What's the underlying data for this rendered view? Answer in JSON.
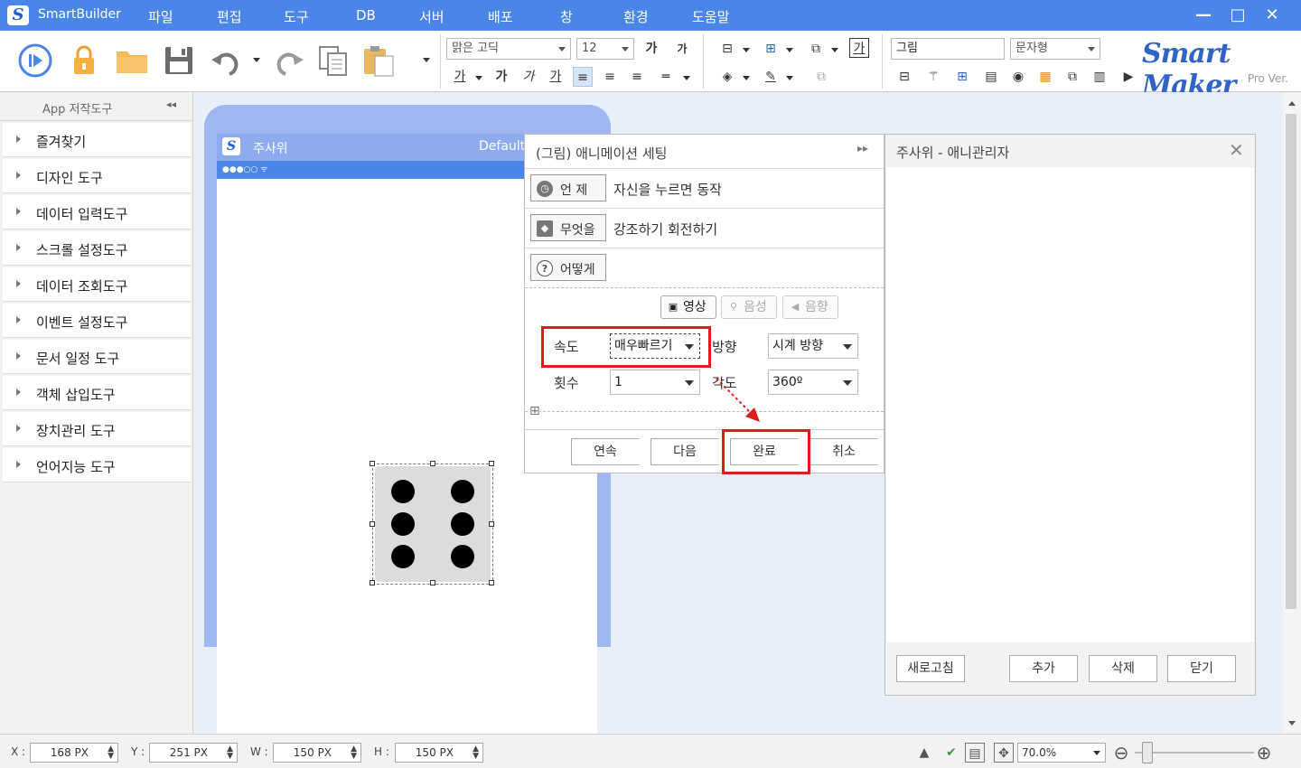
{
  "app": {
    "title": "SmartBuilder",
    "logo_letter": "S"
  },
  "menu": [
    "파일",
    "편집",
    "도구",
    "DB",
    "서버",
    "배포",
    "창",
    "환경",
    "도움말"
  ],
  "window_controls": {
    "minimize": "—",
    "maximize": "□",
    "close": "✕"
  },
  "toolbar": {
    "font_name": "맑은 고딕",
    "font_size": "12",
    "object_name": "그림",
    "text_type": "문자형",
    "format_row1": [
      "가",
      "가"
    ],
    "format_row2": [
      "가",
      "가",
      "가",
      "가"
    ]
  },
  "brand": {
    "name": "Smart Maker",
    "version": "Pro Ver."
  },
  "sidebar": {
    "title": "App 저작도구",
    "collapse": "◂◂",
    "items": [
      "즐겨찾기",
      "디자인 도구",
      "데이터 입력도구",
      "스크롤 설정도구",
      "데이터 조회도구",
      "이벤트 설정도구",
      "문서 일정 도구",
      "객체 삽입도구",
      "장치관리 도구",
      "언어지능 도구"
    ]
  },
  "phone": {
    "title": "주사위",
    "default_label": "Default",
    "status": "●●●○○ ᯤ"
  },
  "dice": {
    "value": 6,
    "pip_color": "#000000",
    "face_color": "#dcdcdc"
  },
  "anim_panel": {
    "title": "(그림) 애니메이션 세팅",
    "expand": "▸▸",
    "rows": [
      {
        "button": "언 제",
        "icon": "clock-icon",
        "glyph": "◷",
        "desc": "자신을 누르면 동작"
      },
      {
        "button": "무엇을",
        "icon": "cube-icon",
        "glyph": "◆",
        "desc": "강조하기 회전하기"
      },
      {
        "button": "어떻게",
        "icon": "question-icon",
        "glyph": "?",
        "desc": ""
      }
    ],
    "media": {
      "video": "영상",
      "voice": "음성",
      "sound": "음향"
    },
    "speed": {
      "label": "속도",
      "value": "매우빠르기"
    },
    "direction": {
      "label": "방향",
      "value": "시계 방향"
    },
    "count": {
      "label": "횟수",
      "value": "1"
    },
    "angle": {
      "label": "각도",
      "value": "360º"
    },
    "expand_box": "⊞",
    "footer": {
      "continue": "연속",
      "next": "다음",
      "done": "완료",
      "cancel": "취소"
    },
    "highlight_color": "#e01b1b"
  },
  "manager": {
    "title": "주사위 - 애니관리자",
    "close": "✕",
    "buttons": {
      "refresh": "새로고침",
      "add": "추가",
      "delete": "삭제",
      "close": "닫기"
    }
  },
  "statusbar": {
    "x": {
      "label": "X :",
      "value": "168",
      "unit": "PX"
    },
    "y": {
      "label": "Y :",
      "value": "251",
      "unit": "PX"
    },
    "w": {
      "label": "W :",
      "value": "150",
      "unit": "PX"
    },
    "h": {
      "label": "H :",
      "value": "150",
      "unit": "PX"
    },
    "zoom": "70.0%",
    "zoom_out": "⊖",
    "zoom_in": "⊕"
  },
  "colors": {
    "titlebar": "#4a86e8",
    "accent": "#2f63c8",
    "canvas": "#e8effb"
  }
}
